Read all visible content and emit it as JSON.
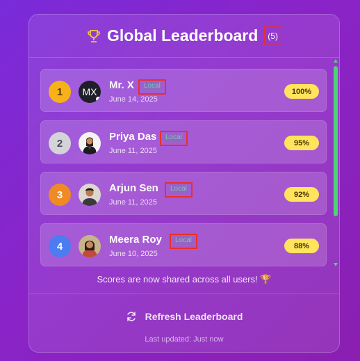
{
  "header": {
    "title": "Global Leaderboard",
    "count": "(5)",
    "icon": "trophy-icon"
  },
  "entries": [
    {
      "rank": "1",
      "initials": "MX",
      "name": "Mr. X",
      "tag": "Local",
      "date": "June 14, 2025",
      "score": "100%",
      "rank_color": "#f7b21a"
    },
    {
      "rank": "2",
      "initials": "",
      "name": "Priya Das",
      "tag": "Local",
      "date": "June 11, 2025",
      "score": "95%",
      "rank_color": "#d4d4d8"
    },
    {
      "rank": "3",
      "initials": "",
      "name": "Arjun Sen",
      "tag": "Local",
      "date": "June 11, 2025",
      "score": "92%",
      "rank_color": "#f08a24"
    },
    {
      "rank": "4",
      "initials": "",
      "name": "Meera Roy",
      "tag": "Local",
      "date": "June 10, 2025",
      "score": "88%",
      "rank_color": "#4b7df0"
    }
  ],
  "note": "Scores are now shared across all users! 🏆",
  "refresh_label": "Refresh Leaderboard",
  "last_updated": "Last updated: Just now",
  "colors": {
    "accent_score": "#ffe45c",
    "scrollbar": "#4cd374",
    "highlight_box": "#e8302a"
  }
}
